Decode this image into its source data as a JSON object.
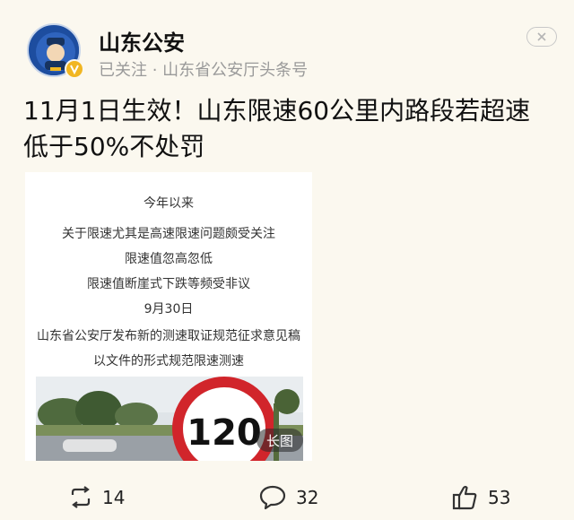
{
  "author": {
    "name": "山东公安",
    "meta": "已关注 · 山东省公安厅头条号"
  },
  "post": {
    "title_line1": "11月1日生效！山东限速60公里内路段若超速",
    "title_line2": "低于50%不处罚"
  },
  "image": {
    "lines": [
      "今年以来",
      "关于限速尤其是高速限速问题颇受关注",
      "限速值忽高忽低",
      "限速值断崖式下跌等频受非议",
      "9月30日",
      "山东省公安厅发布新的测速取证规范征求意见稿",
      "以文件的形式规范限速测速"
    ],
    "sign_value": "120",
    "badge": "长图"
  },
  "actions": {
    "repost_count": "14",
    "comment_count": "32",
    "like_count": "53"
  },
  "colors": {
    "background": "#fbf8ef",
    "avatar_blue": "#1d4d9f",
    "verified_gold": "#f1b622",
    "sign_red": "#d1252b",
    "meta_gray": "#9a9a9a"
  },
  "icons": {
    "repost": "repost-icon",
    "comment": "comment-icon",
    "like": "thumbs-up-icon",
    "close": "close-icon",
    "verified": "verified-v-icon"
  }
}
